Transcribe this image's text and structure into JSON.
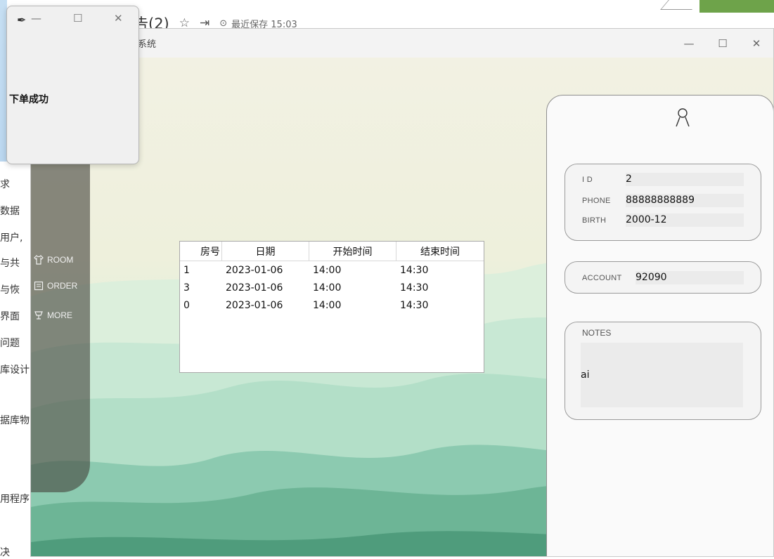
{
  "background_doc": {
    "title": "告(2)",
    "save_status": "最近保存 15:03",
    "sidebar_items": [
      "求",
      "数据",
      "用户,",
      "与共",
      "与恢",
      "界面",
      "问题",
      "库设计",
      "据库物",
      "用程序",
      "决"
    ]
  },
  "main_window": {
    "title": "系统",
    "controls": {
      "minimize": "—",
      "maximize": "☐",
      "close": "✕"
    }
  },
  "nav": {
    "items": [
      {
        "label": "ROOM",
        "icon": "shirt-icon"
      },
      {
        "label": "ORDER",
        "icon": "list-icon"
      },
      {
        "label": "MORE",
        "icon": "cup-icon"
      }
    ]
  },
  "order_table": {
    "headers": [
      "房号",
      "日期",
      "开始时间",
      "结束时间"
    ],
    "rows": [
      [
        "1",
        "2023-01-06",
        "14:00",
        "14:30"
      ],
      [
        "3",
        "2023-01-06",
        "14:00",
        "14:30"
      ],
      [
        "0",
        "2023-01-06",
        "14:00",
        "14:30"
      ]
    ]
  },
  "profile": {
    "id_label": "I D",
    "id_value": "2",
    "phone_label": "PHONE",
    "phone_value": "88888888889",
    "birth_label": "BIRTH",
    "birth_value": "2000-12",
    "account_label": "ACCOUNT",
    "account_value": "92090",
    "notes_label": "NOTES",
    "notes_value": "ai"
  },
  "popup": {
    "message": "下单成功",
    "controls": {
      "minimize": "—",
      "maximize": "☐",
      "close": "✕"
    }
  },
  "colors": {
    "accent_green": "#6ea34a",
    "nav_pill": "#46463e"
  }
}
